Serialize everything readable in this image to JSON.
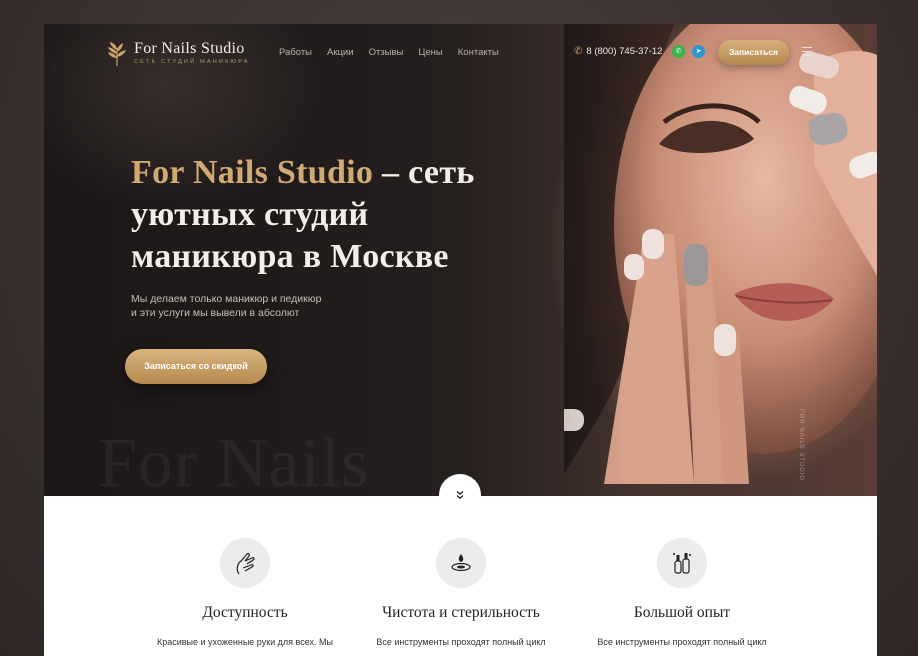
{
  "header": {
    "logo_title": "For Nails Studio",
    "logo_subtitle": "сеть студий маникюра",
    "nav": [
      "Работы",
      "Акции",
      "Отзывы",
      "Цены",
      "Контакты"
    ],
    "phone": "8 (800) 745-37-12",
    "cta_label": "Записаться"
  },
  "hero": {
    "title_brand": "For Nails Studio",
    "title_rest_1": " – сеть",
    "title_line_2": "уютных студий",
    "title_line_3": "маникюра в Москве",
    "lead_line_1": "Мы делаем только маникюр и педикюр",
    "lead_line_2": "и эти услуги мы вывели в абсолют",
    "cta_label": "Записаться со скидкой",
    "watermark": "For Nails",
    "vertical_label": "FOR NAILS STUDIO"
  },
  "features": [
    {
      "title": "Доступность",
      "desc": "Красивые и ухоженные руки для всех. Мы",
      "icon": "hand-icon"
    },
    {
      "title": "Чистота и стерильность",
      "desc": "Все инструменты проходят полный цикл",
      "icon": "drop-icon"
    },
    {
      "title": "Большой опыт",
      "desc": "Все инструменты проходят полный цикл",
      "icon": "nail-polish-icon"
    }
  ],
  "colors": {
    "accent": "#c9a36a",
    "whatsapp": "#36b34a",
    "telegram": "#2f95d4"
  }
}
